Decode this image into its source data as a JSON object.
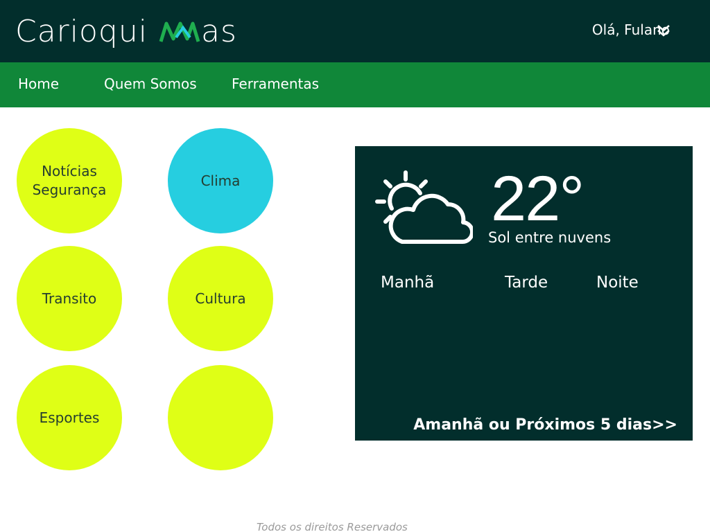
{
  "header": {
    "logo_text": "Carioquinhas",
    "greeting": "Olá, Fulano"
  },
  "nav": {
    "items": [
      {
        "label": "Home"
      },
      {
        "label": "Quem Somos"
      },
      {
        "label": "Ferramentas"
      }
    ]
  },
  "categories": [
    {
      "label": "Notícias\nSegurança",
      "active": false
    },
    {
      "label": "Clima",
      "active": true
    },
    {
      "label": "Transito",
      "active": false
    },
    {
      "label": "Cultura",
      "active": false
    },
    {
      "label": "Esportes",
      "active": false
    },
    {
      "label": "",
      "active": false
    }
  ],
  "weather": {
    "icon": "sun-behind-cloud-icon",
    "temperature": "22°",
    "condition": "Sol entre nuvens",
    "periods": [
      "Manhã",
      "Tarde",
      "Noite"
    ],
    "more_link": "Amanhã ou Próximos 5 dias>>"
  },
  "footer": {
    "text": "Todos os direitos Reservados"
  },
  "colors": {
    "header_bg": "#022e2c",
    "nav_bg": "#108739",
    "circle": "#dfff16",
    "circle_active": "#26cee0",
    "panel_bg": "#022e2c"
  }
}
